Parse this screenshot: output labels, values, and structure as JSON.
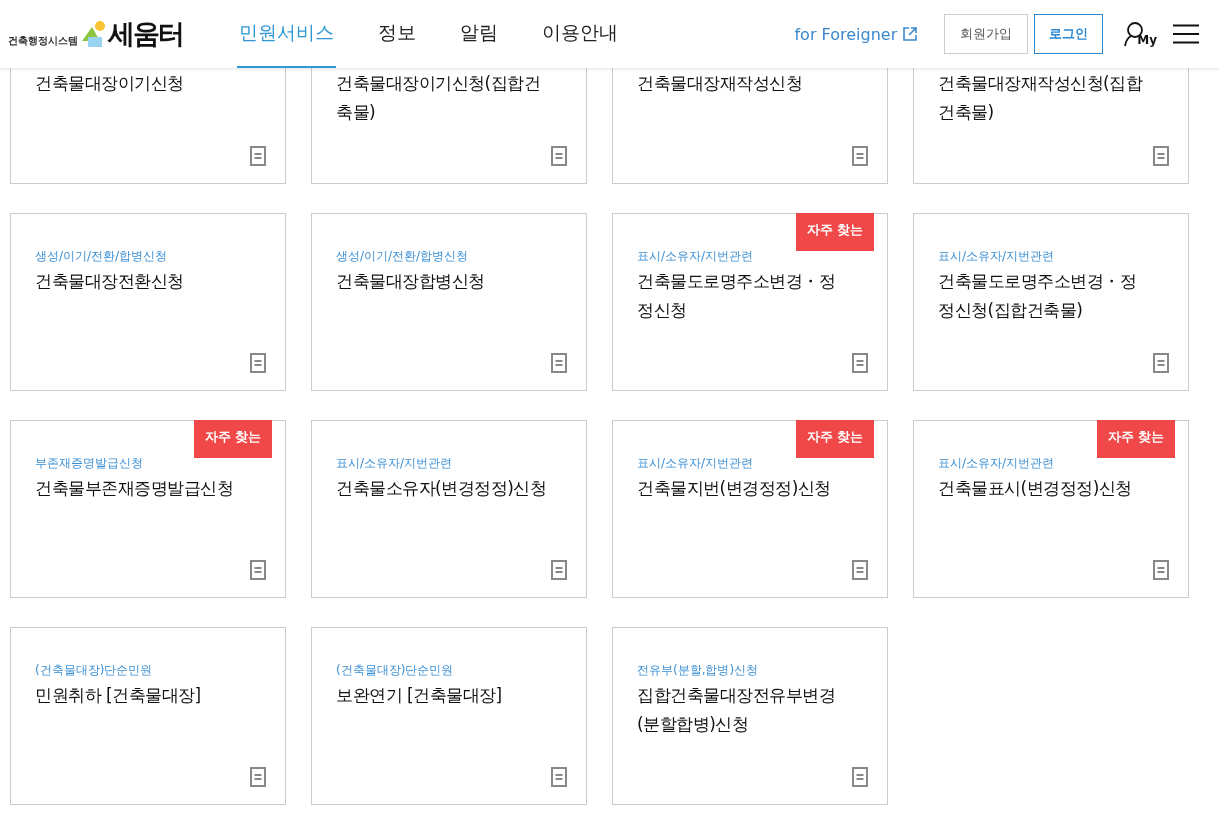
{
  "header": {
    "logo": {
      "title": "세움터",
      "subtitle": "건축행정시스템"
    },
    "nav": [
      {
        "label": "민원서비스",
        "selected": true
      },
      {
        "label": "정보",
        "selected": false
      },
      {
        "label": "알림",
        "selected": false
      },
      {
        "label": "이용안내",
        "selected": false
      }
    ],
    "foreigner_link": "for Foreigner",
    "signup_button": "회원가입",
    "login_button": "로그인",
    "my_label": "My"
  },
  "cards": [
    {
      "title": "건축물대장이기신청",
      "popular": false
    },
    {
      "title": "건축물대장이기신청(집합건축물)",
      "popular": false
    },
    {
      "title": "건축물대장재작성신청",
      "popular": false
    },
    {
      "title": "건축물대장재작성신청(집합건축물)",
      "popular": false
    },
    {
      "category": "생성/이기/전환/합병신청",
      "title": "건축물대장전환신청",
      "popular": false
    },
    {
      "category": "생성/이기/전환/합병신청",
      "title": "건축물대장합병신청",
      "popular": false
    },
    {
      "category": "표시/소유자/지번관련",
      "title": "건축물도로명주소변경・정정신청",
      "popular": true,
      "badge": "자주 찾는"
    },
    {
      "category": "표시/소유자/지번관련",
      "title": "건축물도로명주소변경・정정신청(집합건축물)",
      "popular": false
    },
    {
      "category": "부존재증명발급신청",
      "title": "건축물부존재증명발급신청",
      "popular": true,
      "badge": "자주 찾는"
    },
    {
      "category": "표시/소유자/지번관련",
      "title": "건축물소유자(변경정정)신청",
      "popular": false
    },
    {
      "category": "표시/소유자/지번관련",
      "title": "건축물지번(변경정정)신청",
      "popular": true,
      "badge": "자주 찾는"
    },
    {
      "category": "표시/소유자/지번관련",
      "title": "건축물표시(변경정정)신청",
      "popular": true,
      "badge": "자주 찾는"
    },
    {
      "category": "(건축물대장)단순민원",
      "title": "민원취하 [건축물대장]",
      "popular": false
    },
    {
      "category": "(건축물대장)단순민원",
      "title": "보완연기 [건축물대장]",
      "popular": false
    },
    {
      "category": "전유부(분할,합병)신청",
      "title": "집합건축물대장전유부변경(분할합병)신청",
      "popular": false
    }
  ]
}
